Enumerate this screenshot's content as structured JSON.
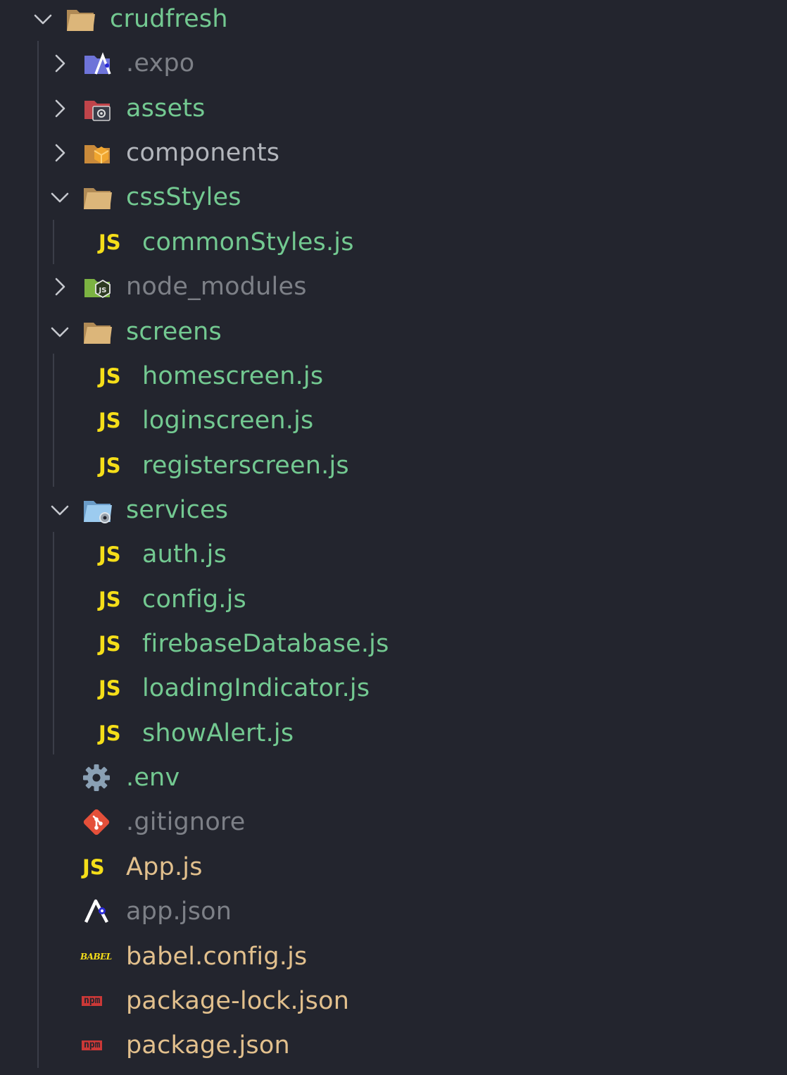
{
  "colors": {
    "background": "#23252e",
    "modified_green": "#73c991",
    "ignored_gray": "#7d8087",
    "untracked_tan": "#e2c08d",
    "js_yellow": "#f5de19"
  },
  "tree": {
    "root": {
      "label": "crudfresh",
      "expanded": true,
      "icon": "folder-open-icon"
    },
    "items": [
      {
        "label": ".expo",
        "kind": "folder",
        "expanded": false,
        "icon": "expo-folder-icon"
      },
      {
        "label": "assets",
        "kind": "folder",
        "expanded": false,
        "icon": "assets-folder-icon"
      },
      {
        "label": "components",
        "kind": "folder",
        "expanded": false,
        "icon": "components-folder-icon"
      },
      {
        "label": "cssStyles",
        "kind": "folder",
        "expanded": true,
        "icon": "folder-open-icon"
      },
      {
        "label": "commonStyles.js",
        "kind": "file",
        "icon": "js-file-icon",
        "icon_text": "JS"
      },
      {
        "label": "node_modules",
        "kind": "folder",
        "expanded": false,
        "icon": "node-folder-icon"
      },
      {
        "label": "screens",
        "kind": "folder",
        "expanded": true,
        "icon": "folder-open-icon"
      },
      {
        "label": "homescreen.js",
        "kind": "file",
        "icon": "js-file-icon",
        "icon_text": "JS"
      },
      {
        "label": "loginscreen.js",
        "kind": "file",
        "icon": "js-file-icon",
        "icon_text": "JS"
      },
      {
        "label": "registerscreen.js",
        "kind": "file",
        "icon": "js-file-icon",
        "icon_text": "JS"
      },
      {
        "label": "services",
        "kind": "folder",
        "expanded": true,
        "icon": "services-folder-icon"
      },
      {
        "label": "auth.js",
        "kind": "file",
        "icon": "js-file-icon",
        "icon_text": "JS"
      },
      {
        "label": "config.js",
        "kind": "file",
        "icon": "js-file-icon",
        "icon_text": "JS"
      },
      {
        "label": "firebaseDatabase.js",
        "kind": "file",
        "icon": "js-file-icon",
        "icon_text": "JS"
      },
      {
        "label": "loadingIndicator.js",
        "kind": "file",
        "icon": "js-file-icon",
        "icon_text": "JS"
      },
      {
        "label": "showAlert.js",
        "kind": "file",
        "icon": "js-file-icon",
        "icon_text": "JS"
      },
      {
        "label": ".env",
        "kind": "file",
        "icon": "gear-icon"
      },
      {
        "label": ".gitignore",
        "kind": "file",
        "icon": "git-icon"
      },
      {
        "label": "App.js",
        "kind": "file",
        "icon": "js-file-icon",
        "icon_text": "JS"
      },
      {
        "label": "app.json",
        "kind": "file",
        "icon": "expo-icon"
      },
      {
        "label": "babel.config.js",
        "kind": "file",
        "icon": "babel-icon",
        "icon_text": "BABEL"
      },
      {
        "label": "package-lock.json",
        "kind": "file",
        "icon": "npm-icon",
        "icon_text": "npm"
      },
      {
        "label": "package.json",
        "kind": "file",
        "icon": "npm-icon",
        "icon_text": "npm"
      }
    ]
  }
}
